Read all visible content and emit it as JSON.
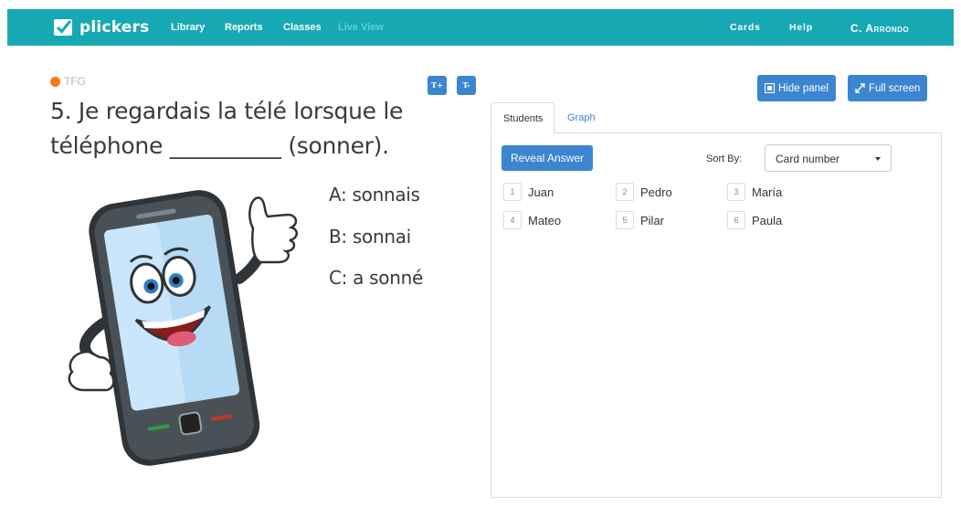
{
  "nav": {
    "brand": "plickers",
    "left_items": [
      "Library",
      "Reports",
      "Classes",
      "Live View"
    ],
    "right_items": [
      "Cards",
      "Help",
      "C. Arrondo"
    ]
  },
  "question": {
    "set_name": "TFG",
    "text": "5. Je regardais la télé lorsque le téléphone __________ (sonner).",
    "choices": [
      "A: sonnais",
      "B: sonnai",
      "C: a sonné"
    ]
  },
  "controls": {
    "font_up": "T+",
    "font_down": "T-",
    "hide_panel": "Hide panel",
    "full_screen": "Full screen"
  },
  "panel": {
    "tabs": [
      "Students",
      "Graph"
    ],
    "reveal_answer": "Reveal Answer",
    "sort_by_label": "Sort By:",
    "sort_by_value": "Card number",
    "students": [
      {
        "num": "1",
        "name": "Juan"
      },
      {
        "num": "2",
        "name": "Pedro"
      },
      {
        "num": "3",
        "name": "María"
      },
      {
        "num": "4",
        "name": "Mateo"
      },
      {
        "num": "5",
        "name": "Pilar"
      },
      {
        "num": "6",
        "name": "Paula"
      }
    ]
  },
  "colors": {
    "nav_bg": "#17a9b3",
    "accent_blue": "#3c85d1",
    "set_dot": "#f47c20"
  }
}
